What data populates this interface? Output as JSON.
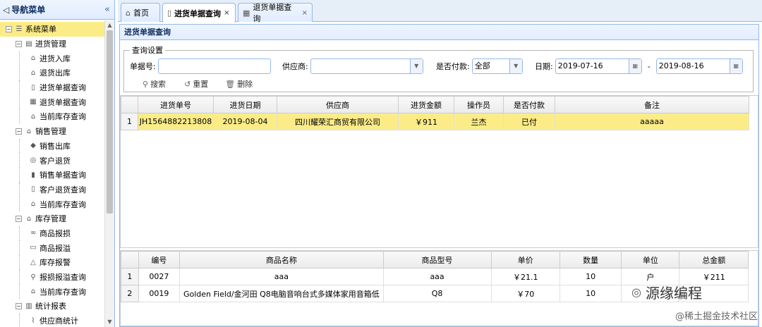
{
  "nav": {
    "title": "导航菜单",
    "collapse_glyph": "«",
    "items": [
      {
        "label": "系统菜单",
        "level": 0,
        "toggle": "⊟",
        "icon": "list-icon",
        "glyph": "☰",
        "selected": true
      },
      {
        "label": "进货管理",
        "level": 1,
        "toggle": "⊟",
        "icon": "doc-icon",
        "glyph": "▤"
      },
      {
        "label": "进货入库",
        "level": 2,
        "icon": "house-icon",
        "glyph": "⌂"
      },
      {
        "label": "退货出库",
        "level": 2,
        "icon": "house-icon",
        "glyph": "⌂"
      },
      {
        "label": "进货单据查询",
        "level": 2,
        "icon": "form-icon",
        "glyph": "▯"
      },
      {
        "label": "退货单据查询",
        "level": 2,
        "icon": "calendar-icon",
        "glyph": "▦"
      },
      {
        "label": "当前库存查询",
        "level": 2,
        "icon": "house-icon",
        "glyph": "⌂"
      },
      {
        "label": "销售管理",
        "level": 1,
        "toggle": "⊟",
        "icon": "house-icon",
        "glyph": "⌂"
      },
      {
        "label": "销售出库",
        "level": 2,
        "icon": "tag-icon",
        "glyph": "◆"
      },
      {
        "label": "客户退货",
        "level": 2,
        "icon": "coin-icon",
        "glyph": "◎"
      },
      {
        "label": "销售单据查询",
        "level": 2,
        "icon": "receipt-icon",
        "glyph": "▮"
      },
      {
        "label": "客户退货查询",
        "level": 2,
        "icon": "receipt-icon",
        "glyph": "▯"
      },
      {
        "label": "当前库存查询",
        "level": 2,
        "icon": "house-icon",
        "glyph": "⌂"
      },
      {
        "label": "库存管理",
        "level": 1,
        "toggle": "⊟",
        "icon": "house-icon",
        "glyph": "⌂"
      },
      {
        "label": "商品报损",
        "level": 2,
        "icon": "link-icon",
        "glyph": "∞"
      },
      {
        "label": "商品报溢",
        "level": 2,
        "icon": "box-icon",
        "glyph": "▭"
      },
      {
        "label": "库存报警",
        "level": 2,
        "icon": "warning-icon",
        "glyph": "△"
      },
      {
        "label": "报损报溢查询",
        "level": 2,
        "icon": "search-icon",
        "glyph": "⚲"
      },
      {
        "label": "当前库存查询",
        "level": 2,
        "icon": "house-icon",
        "glyph": "⌂"
      },
      {
        "label": "统计报表",
        "level": 1,
        "toggle": "⊟",
        "icon": "bar-chart-icon",
        "glyph": "▥"
      },
      {
        "label": "供应商统计",
        "level": 2,
        "icon": "chart-icon",
        "glyph": "⌇"
      }
    ]
  },
  "tabs": [
    {
      "label": "首页",
      "icon": "home-icon",
      "glyph": "⌂",
      "closable": false,
      "active": false
    },
    {
      "label": "进货单据查询",
      "icon": "form-icon",
      "glyph": "▯",
      "closable": true,
      "active": true
    },
    {
      "label": "退货单据查询",
      "icon": "calendar-icon",
      "glyph": "▦",
      "closable": true,
      "active": false
    }
  ],
  "panel": {
    "title": "进货单据查询"
  },
  "query": {
    "legend": "查询设置",
    "bill_no_label": "单据号:",
    "bill_no_value": "",
    "supplier_label": "供应商:",
    "supplier_value": "",
    "paid_label": "是否付款:",
    "paid_value": "全部",
    "date_label": "日期:",
    "date_from": "2019-07-16",
    "date_sep": "-",
    "date_to": "2019-08-16",
    "search_label": "搜索",
    "reset_label": "重置",
    "delete_label": "删除"
  },
  "bills": {
    "columns": [
      "",
      "进货单号",
      "进货日期",
      "供应商",
      "进货金额",
      "操作员",
      "是否付款",
      "备注"
    ],
    "rows": [
      [
        "1",
        "JH1564882213808",
        "2019-08-04",
        "四川耀荣汇商贸有限公司",
        "￥911",
        "兰杰",
        "已付",
        "aaaaa"
      ]
    ]
  },
  "items": {
    "columns": [
      "",
      "编号",
      "商品名称",
      "商品型号",
      "单价",
      "数量",
      "单位",
      "总金额"
    ],
    "rows": [
      [
        "1",
        "0027",
        "aaa",
        "aaa",
        "￥21.1",
        "10",
        "户",
        "￥211"
      ],
      [
        "2",
        "0019",
        "Golden Field/金河田 Q8电脑音响台式多媒体家用音箱低",
        "Q8",
        "￥70",
        "10",
        "",
        ""
      ]
    ]
  },
  "watermark": {
    "brand": "源缘编程",
    "site": "@稀土掘金技术社区"
  }
}
